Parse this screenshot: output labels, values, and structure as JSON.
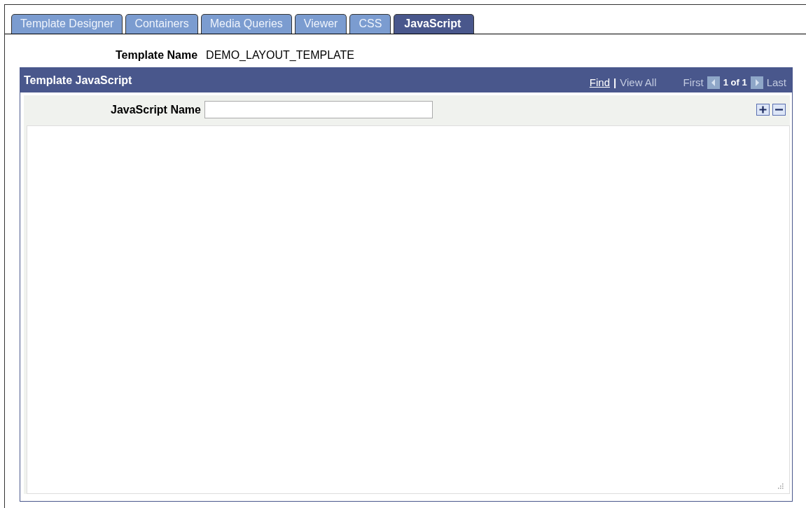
{
  "tabs": [
    {
      "label": "Template Designer",
      "selected": false
    },
    {
      "label": "Containers",
      "selected": false
    },
    {
      "label": "Media Queries",
      "selected": false
    },
    {
      "label": "Viewer",
      "selected": false
    },
    {
      "label": "CSS",
      "selected": false
    },
    {
      "label": "JavaScript",
      "selected": true
    }
  ],
  "template_name": {
    "label": "Template Name",
    "value": "DEMO_LAYOUT_TEMPLATE"
  },
  "panel": {
    "title": "Template JavaScript",
    "find": "Find",
    "separator": "|",
    "view_all": "View All",
    "first": "First",
    "count": "1 of 1",
    "last": "Last",
    "field": {
      "label": "JavaScript Name"
    }
  }
}
